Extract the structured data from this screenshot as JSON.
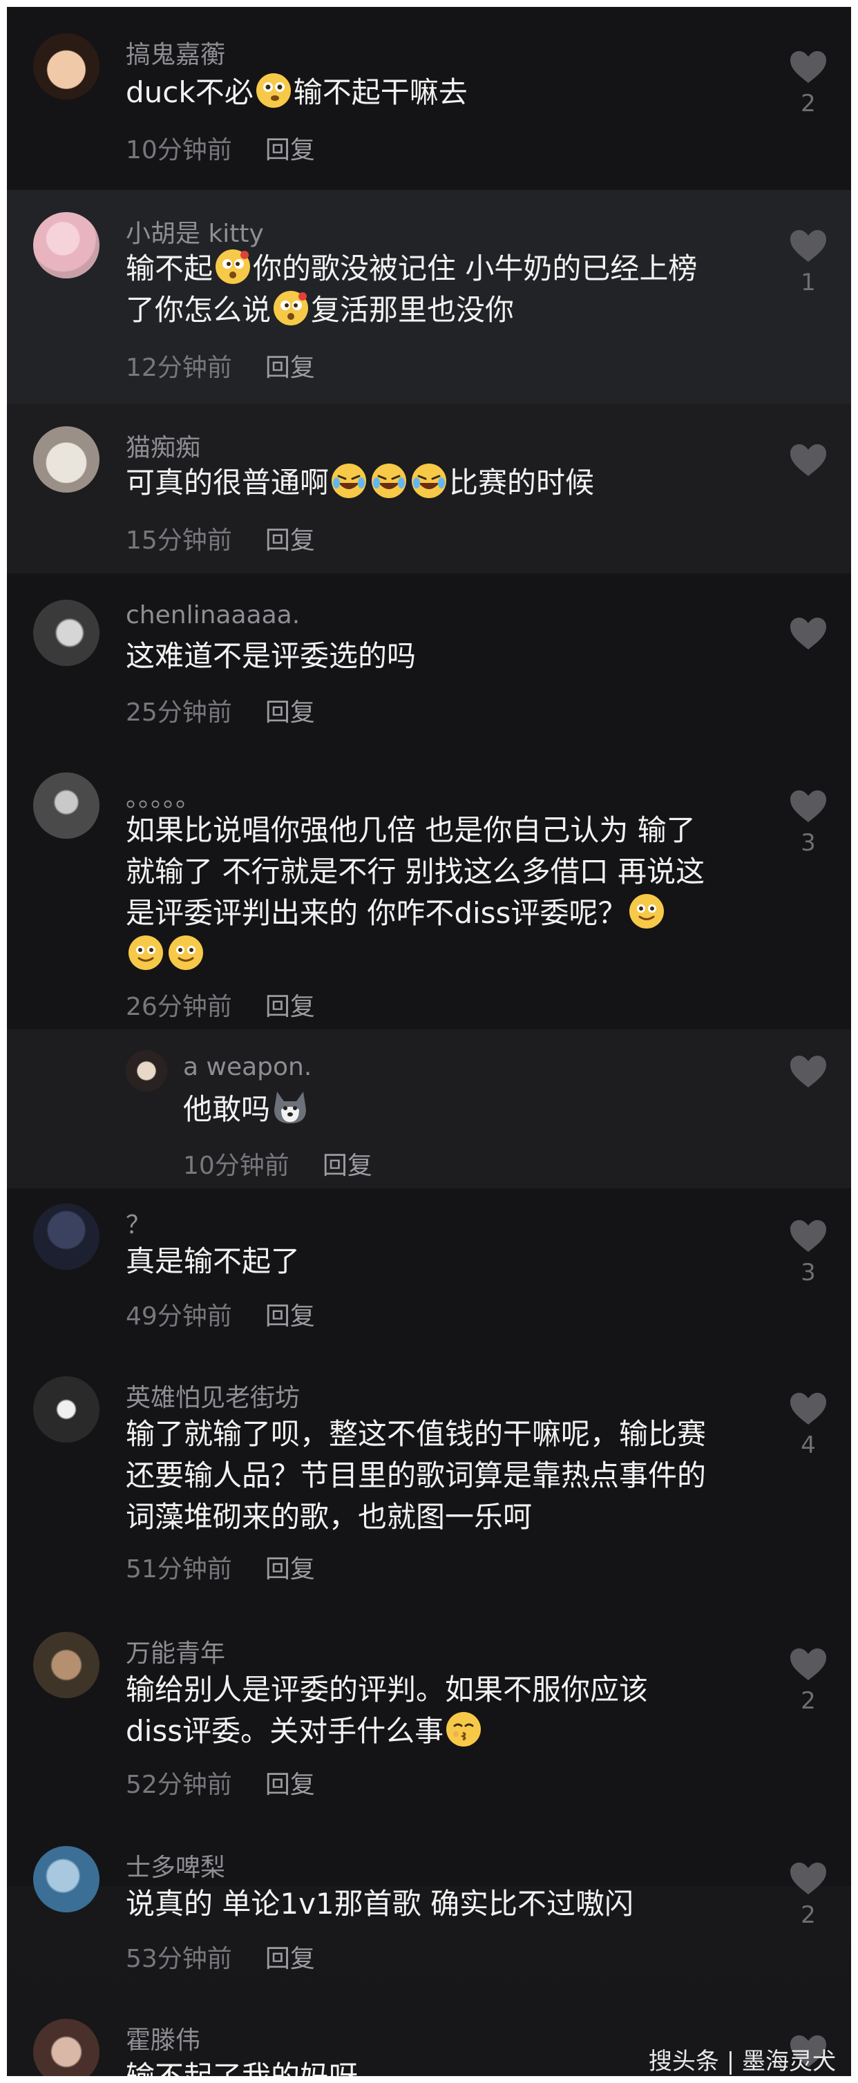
{
  "comments": [
    {
      "username": "搞鬼嘉蘅",
      "text_a": "duck不必",
      "text_b": "输不起干嘛去",
      "time": "10分钟前",
      "reply": "回复",
      "likes": "2"
    },
    {
      "username": "小胡是 kitty",
      "text_a": "输不起",
      "text_b": "你的歌没被记住 小牛奶的已经上榜",
      "text_c": "了你怎么说",
      "text_d": "复活那里也没你",
      "time": "12分钟前",
      "reply": "回复",
      "likes": "1"
    },
    {
      "username": "猫痴痴",
      "text_a": "可真的很普通啊",
      "text_b": "比赛的时候",
      "time": "15分钟前",
      "reply": "回复",
      "likes": ""
    },
    {
      "username": "chenlinaaaaa.",
      "text_a": "这难道不是评委选的吗",
      "time": "25分钟前",
      "reply": "回复",
      "likes": ""
    },
    {
      "username": "。。。。。",
      "text_a": "如果比说唱你强他几倍 也是你自己认为 输了",
      "text_b": "就输了 不行就是不行 别找这么多借口 再说这",
      "text_c": "是评委评判出来的 你咋不diss评委呢？",
      "time": "26分钟前",
      "reply": "回复",
      "likes": "3"
    },
    {
      "username": "a weapon.",
      "text_a": "他敢吗",
      "time": "10分钟前",
      "reply": "回复",
      "likes": ""
    },
    {
      "username": "？",
      "text_a": "真是输不起了",
      "time": "49分钟前",
      "reply": "回复",
      "likes": "3"
    },
    {
      "username": "英雄怕见老街坊",
      "text_a": "输了就输了呗，整这不值钱的干嘛呢，输比赛",
      "text_b": "还要输人品？节目里的歌词算是靠热点事件的",
      "text_c": "词藻堆砌来的歌，也就图一乐呵",
      "time": "51分钟前",
      "reply": "回复",
      "likes": "4"
    },
    {
      "username": "万能青年",
      "text_a": "输给别人是评委的评判。如果不服你应该",
      "text_b": "diss评委。关对手什么事",
      "time": "52分钟前",
      "reply": "回复",
      "likes": "2"
    },
    {
      "username": "士多啤梨",
      "text_a": "说真的 单论1v1那首歌 确实比不过嗷闪",
      "time": "53分钟前",
      "reply": "回复",
      "likes": "2"
    },
    {
      "username": "霍滕伟",
      "text_a": "输不起了我的妈呀",
      "time": "",
      "reply": "",
      "likes": ""
    }
  ],
  "watermark": "搜头条 | 墨海灵犬",
  "icons": {
    "like": "heart-icon",
    "emoji_thinking": "thinking-face-emoji",
    "emoji_dizzy": "dizzy-face-emoji",
    "emoji_laugh": "rolling-laughing-emoji",
    "emoji_smile": "smiling-face-emoji",
    "emoji_husky": "husky-dog-emoji",
    "emoji_kiss": "kissing-face-emoji"
  }
}
